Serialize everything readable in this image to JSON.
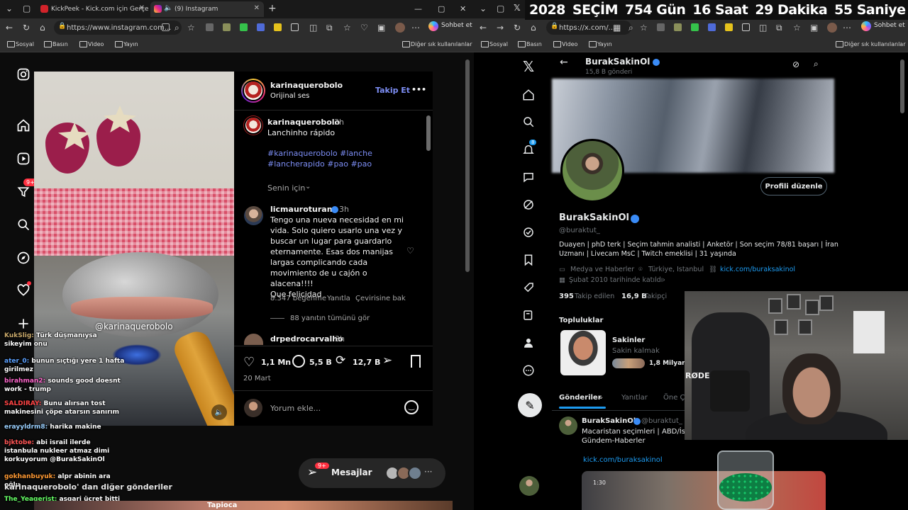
{
  "countdown": [
    "2028",
    "SEÇİM",
    "754 Gün",
    "16 Saat",
    "29 Dakika",
    "55 Saniye"
  ],
  "left_browser": {
    "tabs": [
      {
        "label": "KickPeek - Kick.com için Gerçek Za"
      },
      {
        "label": "(9) Instagram"
      }
    ],
    "url": "https://www.instagram.com...",
    "copilot_label": "Sohbet et",
    "bookmarks": [
      "Sosyal",
      "Basın",
      "Video",
      "Yayın"
    ],
    "other_bookmarks": "Diğer sık kullanılanlar"
  },
  "instagram": {
    "nav_badge": "9+",
    "video_watermark": "@karinaquerobolo",
    "header": {
      "username": "karinaquerobolo",
      "subtitle": "Orijinal ses",
      "follow": "Takip Et",
      "more": "•••"
    },
    "caption": {
      "username": "karinaquerobolo",
      "time": "3h",
      "text": "Lanchinho rápido",
      "hashtags_line1": "#karinaquerobolo #lanche",
      "hashtags_line2": "#lancherapido #pao #pao"
    },
    "for_you": "Senin için",
    "comment": {
      "username": "licmauroturano",
      "time": "3h",
      "lines": [
        "Tengo una nueva necesidad en mi",
        "vida. Solo quiero usarlo una vez y",
        "buscar un lugar para guardarlo",
        "eternamente. Esas dos manijas",
        "largas complicando cada",
        "movimiento de u cajón o alacena!!!!",
        "Que felicidad"
      ],
      "likes": "8.347 beğenme",
      "reply": "Yanıtla",
      "translate": "Çevirisine bak",
      "view_replies": "88 yanıtın tümünü gör"
    },
    "next_comment": {
      "username": "drpedrocarvalho",
      "time": "3h"
    },
    "stats": {
      "likes": "1,1 Mn",
      "comments": "5,5 B",
      "reposts": "12,7 B"
    },
    "date": "20 Mart",
    "add_comment_placeholder": "Yorum ekle...",
    "messages": {
      "label": "Mesajlar",
      "badge": "9+"
    },
    "more_posts": "karinaquerobolo' dan diğer gönderiler",
    "bottom_strip": "Tapioca"
  },
  "chat": [
    {
      "user": "KukSlig:",
      "msg": "Türk düşmanıysa sikeyim onu",
      "ucolor": "#c8a86a"
    },
    {
      "user": "ater_0:",
      "msg": "bunun sıçtığı yere 1 hafta girilmez",
      "ucolor": "#5aa0ff"
    },
    {
      "user": "birahman2:",
      "msg": "sounds good doesnt work - trump",
      "ucolor": "#ff66cc"
    },
    {
      "user": "SALDIRAY:",
      "msg": "Bunu alırsan tost makinesini çöpe atarsın sanırım",
      "ucolor": "#ff4444"
    },
    {
      "user": "erayyldrm8:",
      "msg": "harika makine",
      "ucolor": "#9ad0ff"
    },
    {
      "user": "bjktobe:",
      "msg": "abi israil ilerde istanbula nukleer atmaz dimi korkuyorum @BurakSakinOl",
      "ucolor": "#ff5555"
    },
    {
      "user": "gokhanbuyuk:",
      "msg": "alpr abinin ara oğlu",
      "ucolor": "#ff9933"
    },
    {
      "user": "The_Yeagerist:",
      "msg": "asgari ücret bitti",
      "ucolor": "#66ff66"
    }
  ],
  "right_browser": {
    "url": "https://x.com/...",
    "copilot_label": "Sohbet et",
    "bookmarks": [
      "Sosyal",
      "Basın",
      "Video",
      "Yayın"
    ],
    "other_bookmarks": "Diğer sık kullanılanlar"
  },
  "x_profile": {
    "header_name": "BurakSakinOl",
    "header_posts": "15,8 B gönderi",
    "edit_profile": "Profili düzenle",
    "name": "BurakSakinOl",
    "handle": "@buraktut_",
    "bio_line1": "Duayen | phD terk | Seçim tahmin analisti | Anketör | Son seçim 78/81 başarı | İran",
    "bio_line2": "Uzmanı | Livecam MsC | Twitch emeklisi | 31 yaşında",
    "category": "Medya ve Haberler",
    "location": "Türkiye, Istanbul",
    "link": "kick.com/buraksakinol",
    "joined": "Şubat 2010 tarihinde katıldı",
    "following_count": "395",
    "following_label": "Takip edilen",
    "followers_count": "16,9 B",
    "followers_label": "Takipçi",
    "communities_title": "Topluluklar",
    "community": {
      "name": "Sakinler",
      "subtitle": "Sakin kalmak",
      "members": "1,8 Milyar"
    },
    "tabs": [
      "Gönderiler",
      "Yanıtlar",
      "Öne Ç"
    ],
    "notif_badge": "8",
    "post": {
      "name": "BurakSakinOl",
      "handle": "@buraktut_ ·",
      "line1": "Macaristan seçimleri | ABD/İsrail",
      "line2": "Gündem-Haberler",
      "link": "kick.com/buraksakinol",
      "video_time": "1:30"
    },
    "mic_brand": "RØDE"
  }
}
